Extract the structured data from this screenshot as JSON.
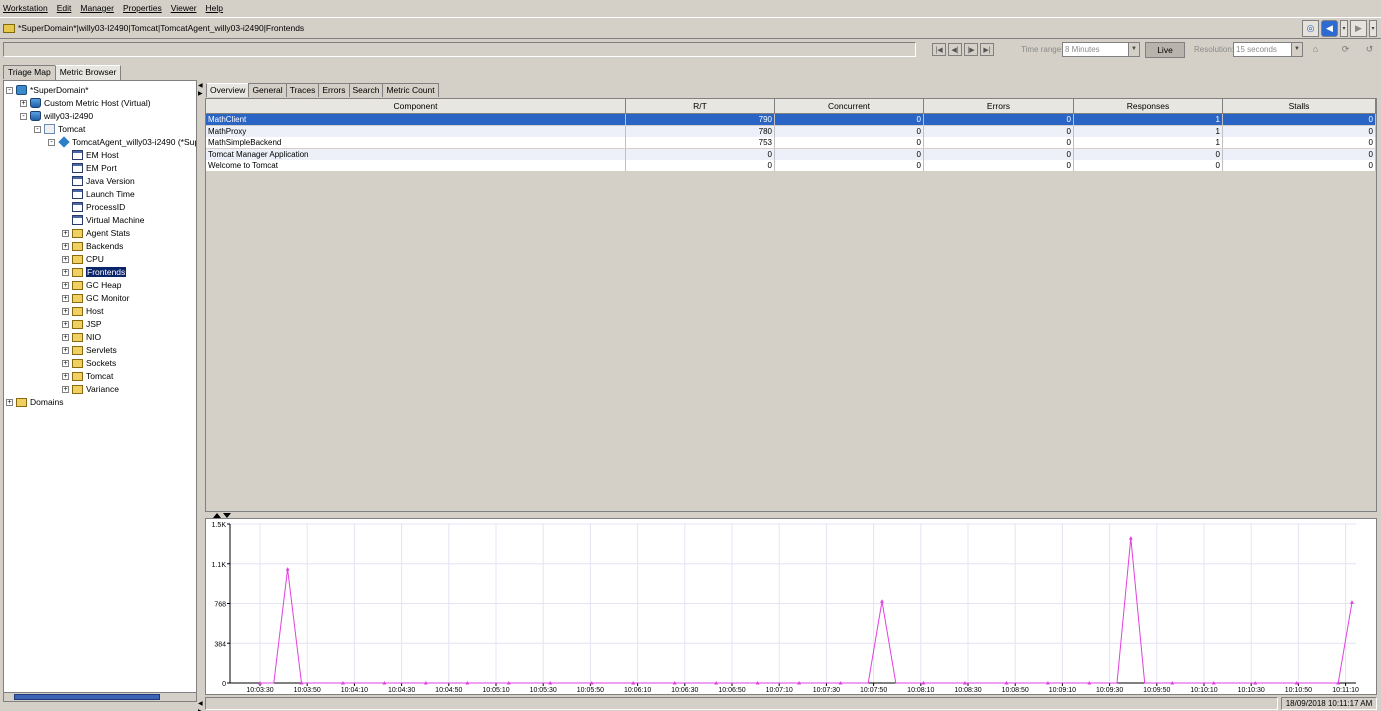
{
  "menu": [
    "Workstation",
    "Edit",
    "Manager",
    "Properties",
    "Viewer",
    "Help"
  ],
  "path": "*SuperDomain*|willy03-I2490|Tomcat|TomcatAgent_willy03-i2490|Frontends",
  "controls": {
    "time_range_label": "Time range:",
    "time_range_value": "8 Minutes",
    "live_label": "Live",
    "resolution_label": "Resolution:",
    "resolution_value": "15 seconds"
  },
  "left_tabs": [
    "Triage Map",
    "Metric Browser"
  ],
  "tree": [
    {
      "label": "*SuperDomain*",
      "icon": "domain",
      "exp": "-",
      "indent": 0
    },
    {
      "label": "Custom Metric Host (Virtual)",
      "icon": "db",
      "exp": "+",
      "indent": 1
    },
    {
      "label": "willy03-i2490",
      "icon": "db",
      "exp": "-",
      "indent": 1
    },
    {
      "label": "Tomcat",
      "icon": "tomcat",
      "exp": "-",
      "indent": 2
    },
    {
      "label": "TomcatAgent_willy03-i2490 (*Supe",
      "icon": "agent",
      "exp": "-",
      "indent": 3
    },
    {
      "label": "EM Host",
      "icon": "doc",
      "exp": "",
      "indent": 4
    },
    {
      "label": "EM Port",
      "icon": "doc",
      "exp": "",
      "indent": 4
    },
    {
      "label": "Java Version",
      "icon": "doc",
      "exp": "",
      "indent": 4
    },
    {
      "label": "Launch Time",
      "icon": "doc",
      "exp": "",
      "indent": 4
    },
    {
      "label": "ProcessID",
      "icon": "doc",
      "exp": "",
      "indent": 4
    },
    {
      "label": "Virtual Machine",
      "icon": "doc",
      "exp": "",
      "indent": 4
    },
    {
      "label": "Agent Stats",
      "icon": "folder",
      "exp": "+",
      "indent": 4
    },
    {
      "label": "Backends",
      "icon": "folder",
      "exp": "+",
      "indent": 4
    },
    {
      "label": "CPU",
      "icon": "folder",
      "exp": "+",
      "indent": 4
    },
    {
      "label": "Frontends",
      "icon": "folder",
      "exp": "+",
      "indent": 4,
      "selected": true
    },
    {
      "label": "GC Heap",
      "icon": "folder",
      "exp": "+",
      "indent": 4
    },
    {
      "label": "GC Monitor",
      "icon": "folder",
      "exp": "+",
      "indent": 4
    },
    {
      "label": "Host",
      "icon": "folder",
      "exp": "+",
      "indent": 4
    },
    {
      "label": "JSP",
      "icon": "folder",
      "exp": "+",
      "indent": 4
    },
    {
      "label": "NIO",
      "icon": "folder",
      "exp": "+",
      "indent": 4
    },
    {
      "label": "Servlets",
      "icon": "folder",
      "exp": "+",
      "indent": 4
    },
    {
      "label": "Sockets",
      "icon": "folder",
      "exp": "+",
      "indent": 4
    },
    {
      "label": "Tomcat",
      "icon": "folder",
      "exp": "+",
      "indent": 4
    },
    {
      "label": "Variance",
      "icon": "folder",
      "exp": "+",
      "indent": 4
    },
    {
      "label": "Domains",
      "icon": "folder",
      "exp": "+",
      "indent": 0
    }
  ],
  "right_tabs": [
    "Overview",
    "General",
    "Traces",
    "Errors",
    "Search",
    "Metric Count"
  ],
  "table": {
    "columns": [
      "Component",
      "R/T",
      "Concurrent",
      "Errors",
      "Responses",
      "Stalls"
    ],
    "rows": [
      [
        "MathClient",
        "790",
        "0",
        "0",
        "1",
        "0"
      ],
      [
        "MathProxy",
        "780",
        "0",
        "0",
        "1",
        "0"
      ],
      [
        "MathSimpleBackend",
        "753",
        "0",
        "0",
        "1",
        "0"
      ],
      [
        "Tomcat Manager Application",
        "0",
        "0",
        "0",
        "0",
        "0"
      ],
      [
        "Welcome to Tomcat",
        "0",
        "0",
        "0",
        "0",
        "0"
      ]
    ],
    "selected_row": 0
  },
  "chart_data": {
    "type": "line",
    "ylim": [
      0,
      1536
    ],
    "yticks": [
      0,
      384,
      768,
      1152,
      1536
    ],
    "yticklabels": [
      "0",
      "384",
      "768",
      "1.1K",
      "1.5K"
    ],
    "xticklabels": [
      "10:03:30",
      "10:03:50",
      "10:04:10",
      "10:04:30",
      "10:04:50",
      "10:05:10",
      "10:05:30",
      "10:05:50",
      "10:06:10",
      "10:06:30",
      "10:06:50",
      "10:07:10",
      "10:07:30",
      "10:07:50",
      "10:08:10",
      "10:08:30",
      "10:08:50",
      "10:09:10",
      "10:09:30",
      "10:09:50",
      "10:10:10",
      "10:10:30",
      "10:10:50",
      "10:11:10"
    ],
    "x_start_label_index": 0,
    "series": [
      {
        "color": "#e040e0",
        "points": [
          [
            0,
            0
          ],
          [
            1,
            0
          ],
          [
            2,
            1100
          ],
          [
            3,
            0
          ],
          [
            4,
            0
          ],
          [
            5,
            0
          ],
          [
            6,
            0
          ],
          [
            7,
            0
          ],
          [
            8,
            0
          ],
          [
            9,
            0
          ],
          [
            10,
            0
          ],
          [
            11,
            0
          ],
          [
            12,
            0
          ],
          [
            13,
            0
          ],
          [
            14,
            0
          ],
          [
            15,
            0
          ],
          [
            16,
            0
          ],
          [
            17,
            0
          ],
          [
            18,
            0
          ],
          [
            19,
            0
          ],
          [
            20,
            0
          ],
          [
            21,
            0
          ],
          [
            22,
            0
          ],
          [
            23,
            0
          ],
          [
            24,
            0
          ],
          [
            25,
            0
          ],
          [
            26,
            0
          ],
          [
            27,
            0
          ],
          [
            28,
            0
          ],
          [
            29,
            0
          ],
          [
            30,
            0
          ],
          [
            31,
            0
          ],
          [
            32,
            0
          ],
          [
            33,
            0
          ],
          [
            34,
            0
          ],
          [
            35,
            0
          ],
          [
            36,
            0
          ],
          [
            37,
            0
          ],
          [
            38,
            0
          ],
          [
            39,
            0
          ],
          [
            40,
            0
          ],
          [
            41,
            0
          ],
          [
            42,
            0
          ],
          [
            43,
            0
          ],
          [
            44,
            0
          ],
          [
            45,
            790
          ],
          [
            46,
            0
          ],
          [
            47,
            0
          ],
          [
            48,
            0
          ],
          [
            49,
            0
          ],
          [
            50,
            0
          ],
          [
            51,
            0
          ],
          [
            52,
            0
          ],
          [
            53,
            0
          ],
          [
            54,
            0
          ],
          [
            55,
            0
          ],
          [
            56,
            0
          ],
          [
            57,
            0
          ],
          [
            58,
            0
          ],
          [
            59,
            0
          ],
          [
            60,
            0
          ],
          [
            61,
            0
          ],
          [
            62,
            0
          ],
          [
            63,
            1400
          ],
          [
            64,
            0
          ],
          [
            65,
            0
          ],
          [
            66,
            0
          ],
          [
            67,
            0
          ],
          [
            68,
            0
          ],
          [
            69,
            0
          ],
          [
            70,
            0
          ],
          [
            71,
            0
          ],
          [
            72,
            0
          ],
          [
            73,
            0
          ],
          [
            74,
            0
          ],
          [
            75,
            0
          ],
          [
            76,
            0
          ],
          [
            77,
            0
          ],
          [
            78,
            0
          ],
          [
            79,
            780
          ]
        ]
      }
    ]
  },
  "status": {
    "datetime": "18/09/2018 10:11:17 AM"
  }
}
